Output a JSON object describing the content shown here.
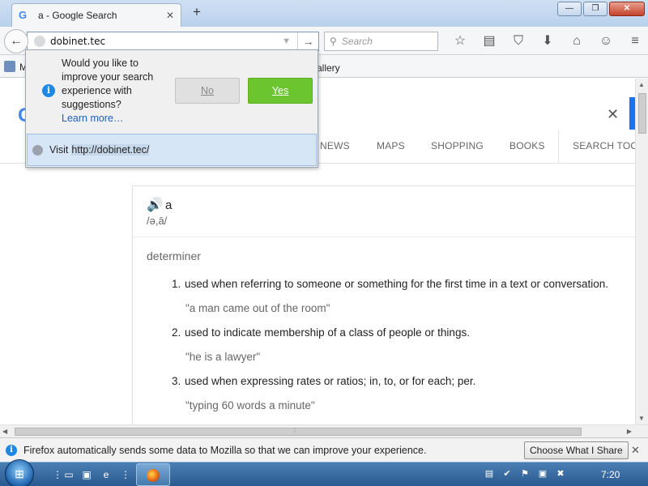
{
  "browser": {
    "tab": {
      "title": "a - Google Search",
      "favicon": "G",
      "close_icon": "✕"
    },
    "new_tab_icon": "+",
    "window_buttons": [
      "—",
      "❐",
      "✕"
    ],
    "url": {
      "value": "dobinet.tec"
    },
    "search": {
      "placeholder": "Search"
    },
    "toolbar_icons": [
      "star-icon",
      "reader-list-icon",
      "pocket-icon",
      "download-icon",
      "home-icon",
      "hello-icon",
      "menu-icon"
    ],
    "bookmarks": {
      "first_label": "M",
      "gallery_label": "allery"
    }
  },
  "popup": {
    "message": "Would you like to improve your search experience with suggestions?",
    "learn_more": "Learn more…",
    "no_label": "No",
    "yes_label": "Yes",
    "visit_label": "Visit",
    "visit_url": "http://dobinet.tec/"
  },
  "google": {
    "logo": "G",
    "close": "✕",
    "tabs": [
      "NEWS",
      "MAPS",
      "SHOPPING",
      "BOOKS",
      "SEARCH TOOLS"
    ],
    "word": "a",
    "phonetic": "/ə,ā/",
    "part_of_speech": "determiner",
    "definitions": [
      {
        "num": "1.",
        "text": "used when referring to someone or something for the first time in a text or conversation.",
        "example": "\"a man came out of the room\""
      },
      {
        "num": "2.",
        "text": "used to indicate membership of a class of people or things.",
        "example": "\"he is a lawyer\""
      },
      {
        "num": "3.",
        "text": "used when expressing rates or ratios; in, to, or for each; per.",
        "example": "\"typing 60 words a minute\""
      }
    ]
  },
  "notification": {
    "text": "Firefox automatically sends some data to Mozilla so that we can improve your experience.",
    "button": "Choose What I Share",
    "close": "✕"
  },
  "taskbar": {
    "clock": "7:20"
  },
  "colors": {
    "accent": "#1e88e5",
    "yes_button": "#6ac52e",
    "taskbar": "#2a5a8f"
  }
}
